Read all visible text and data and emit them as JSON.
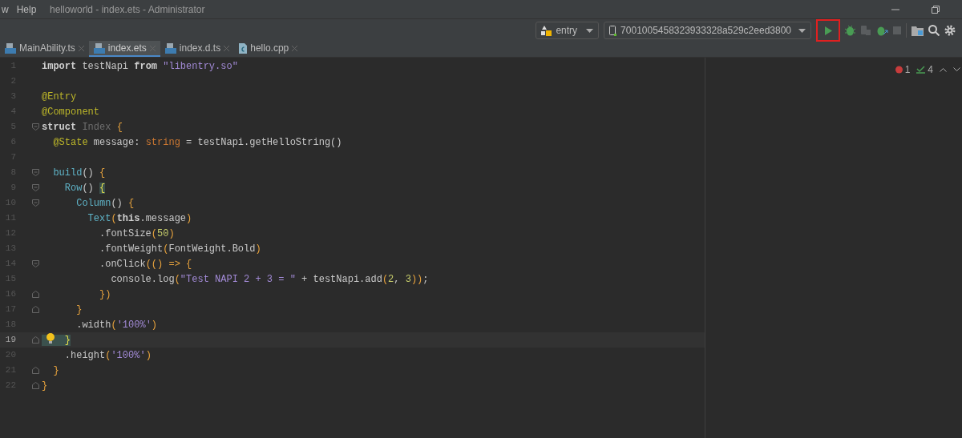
{
  "menu": [
    "w",
    "Help"
  ],
  "window": {
    "title": "helloworld - index.ets - Administrator"
  },
  "toolbar": {
    "module": "entry",
    "device": "7001005458323933328a529c2eed3800"
  },
  "tabs": [
    {
      "label": "MainAbility.ts",
      "selected": false,
      "kind": "ts"
    },
    {
      "label": "index.ets",
      "selected": true,
      "kind": "ts"
    },
    {
      "label": "index.d.ts",
      "selected": false,
      "kind": "ts"
    },
    {
      "label": "hello.cpp",
      "selected": false,
      "kind": "cpp"
    }
  ],
  "inspections": {
    "errors": "1",
    "warnings": "4"
  },
  "code": [
    {
      "number": "1",
      "tokens": [
        {
          "text": "import ",
          "kind": "keyword"
        },
        {
          "text": "testNapi ",
          "kind": "plain"
        },
        {
          "text": "from ",
          "kind": "keyword"
        },
        {
          "text": "\"libentry.so\"",
          "kind": "string"
        }
      ]
    },
    {
      "number": "2"
    },
    {
      "number": "3",
      "tokens": [
        {
          "text": "@Entry",
          "kind": "decorator"
        }
      ]
    },
    {
      "number": "4",
      "tokens": [
        {
          "text": "@Component",
          "kind": "decorator"
        }
      ]
    },
    {
      "number": "5",
      "fold_start": true,
      "tokens": [
        {
          "text": "struct ",
          "kind": "keyword"
        },
        {
          "text": "Index ",
          "kind": "dim"
        },
        {
          "text": "{",
          "kind": "brace"
        }
      ]
    },
    {
      "number": "6",
      "tokens": [
        {
          "text": "  @State ",
          "kind": "decorator"
        },
        {
          "text": "message: ",
          "kind": "plain"
        },
        {
          "text": "string ",
          "kind": "type"
        },
        {
          "text": "= testNapi.getHelloString()",
          "kind": "plain"
        }
      ]
    },
    {
      "number": "7"
    },
    {
      "number": "8",
      "fold_start": true,
      "tokens": [
        {
          "text": "  build",
          "kind": "component"
        },
        {
          "text": "() ",
          "kind": "plain"
        },
        {
          "text": "{",
          "kind": "brace"
        }
      ]
    },
    {
      "number": "9",
      "fold_start": true,
      "tokens": [
        {
          "text": "    Row",
          "kind": "component"
        },
        {
          "text": "() ",
          "kind": "plain"
        },
        {
          "text": "{",
          "kind": "match"
        }
      ]
    },
    {
      "number": "10",
      "fold_start": true,
      "tokens": [
        {
          "text": "      Column",
          "kind": "component"
        },
        {
          "text": "() ",
          "kind": "plain"
        },
        {
          "text": "{",
          "kind": "brace"
        }
      ]
    },
    {
      "number": "11",
      "tokens": [
        {
          "text": "        Text",
          "kind": "component"
        },
        {
          "text": "(",
          "kind": "brace"
        },
        {
          "text": "this",
          "kind": "keyword"
        },
        {
          "text": ".message",
          "kind": "plain"
        },
        {
          "text": ")",
          "kind": "brace"
        }
      ]
    },
    {
      "number": "12",
      "tokens": [
        {
          "text": "          .fontSize",
          "kind": "plain"
        },
        {
          "text": "(",
          "kind": "brace"
        },
        {
          "text": "50",
          "kind": "number"
        },
        {
          "text": ")",
          "kind": "brace"
        }
      ]
    },
    {
      "number": "13",
      "tokens": [
        {
          "text": "          .fontWeight",
          "kind": "plain"
        },
        {
          "text": "(",
          "kind": "brace"
        },
        {
          "text": "FontWeight.Bold",
          "kind": "plain"
        },
        {
          "text": ")",
          "kind": "brace"
        }
      ]
    },
    {
      "number": "14",
      "fold_start": true,
      "tokens": [
        {
          "text": "          .onClick",
          "kind": "plain"
        },
        {
          "text": "(() => {",
          "kind": "brace"
        }
      ]
    },
    {
      "number": "15",
      "tokens": [
        {
          "text": "            console.log",
          "kind": "plain"
        },
        {
          "text": "(",
          "kind": "brace"
        },
        {
          "text": "\"Test NAPI 2 + 3 = \" ",
          "kind": "string"
        },
        {
          "text": "+ testNapi.add",
          "kind": "plain"
        },
        {
          "text": "(",
          "kind": "brace"
        },
        {
          "text": "2",
          "kind": "number"
        },
        {
          "text": ", ",
          "kind": "plain"
        },
        {
          "text": "3",
          "kind": "number"
        },
        {
          "text": "))",
          "kind": "brace"
        },
        {
          "text": ";",
          "kind": "plain"
        }
      ]
    },
    {
      "number": "16",
      "fold_end": true,
      "tokens": [
        {
          "text": "          })",
          "kind": "brace"
        }
      ]
    },
    {
      "number": "17",
      "fold_end": true,
      "tokens": [
        {
          "text": "      }",
          "kind": "brace"
        }
      ]
    },
    {
      "number": "18",
      "tokens": [
        {
          "text": "      .width",
          "kind": "plain"
        },
        {
          "text": "(",
          "kind": "brace"
        },
        {
          "text": "'100%'",
          "kind": "string"
        },
        {
          "text": ")",
          "kind": "brace"
        }
      ]
    },
    {
      "number": "19",
      "fold_end": true,
      "current": true,
      "intention": true,
      "tokens": [
        {
          "text": "    }",
          "kind": "match"
        }
      ]
    },
    {
      "number": "20",
      "tokens": [
        {
          "text": "    .height",
          "kind": "plain"
        },
        {
          "text": "(",
          "kind": "brace"
        },
        {
          "text": "'100%'",
          "kind": "string"
        },
        {
          "text": ")",
          "kind": "brace"
        }
      ]
    },
    {
      "number": "21",
      "fold_end": true,
      "tokens": [
        {
          "text": "  }",
          "kind": "brace"
        }
      ]
    },
    {
      "number": "22",
      "fold_end": true,
      "tokens": [
        {
          "text": "}",
          "kind": "brace"
        }
      ]
    }
  ]
}
